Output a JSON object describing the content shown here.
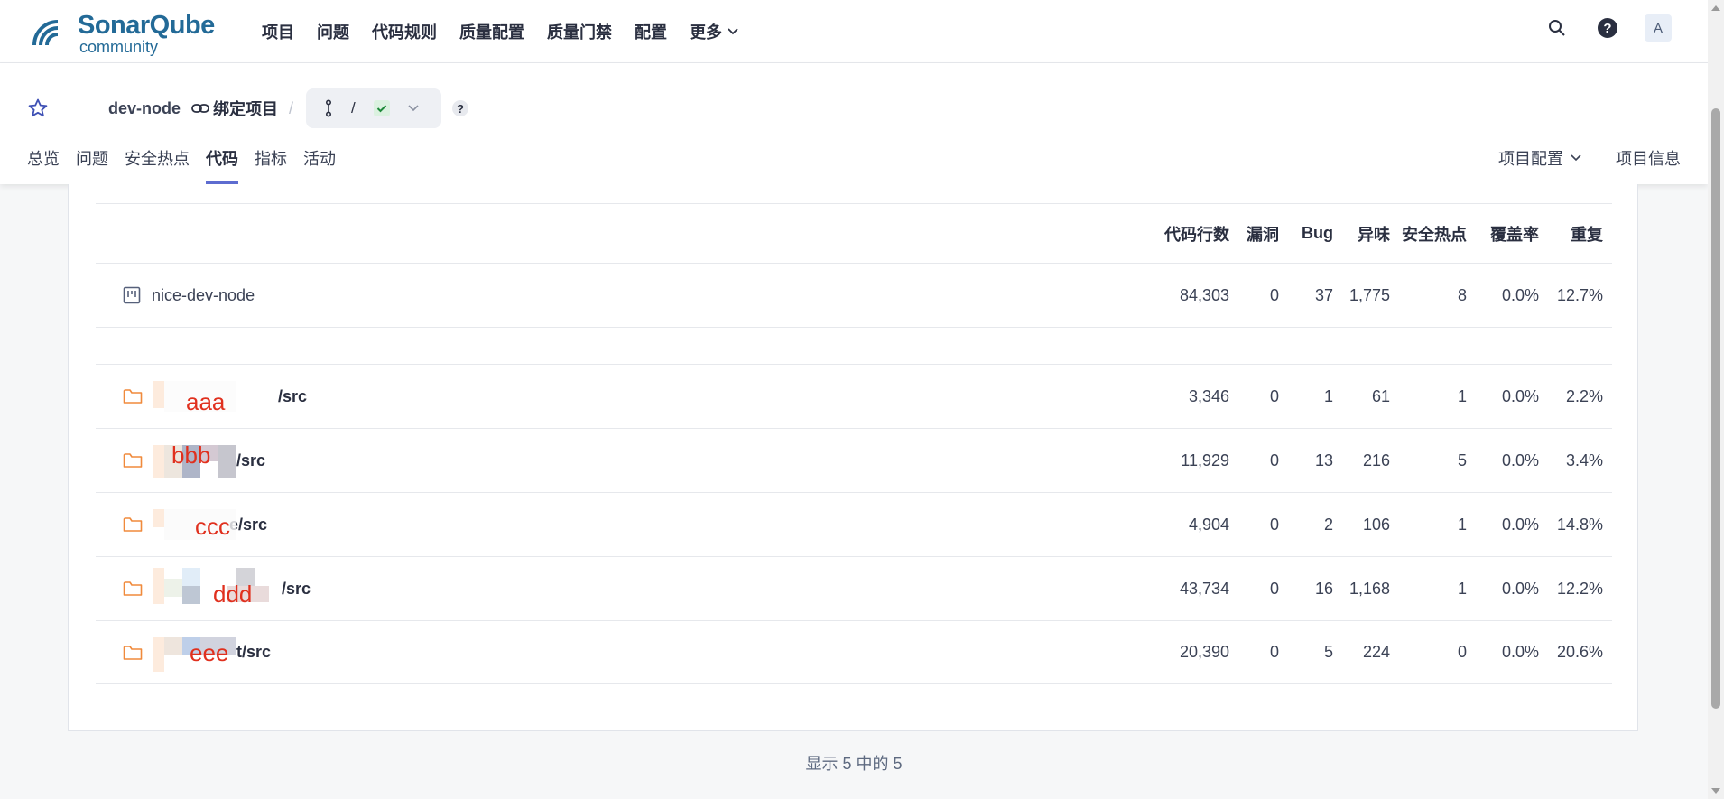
{
  "brand": {
    "name": "SonarQube",
    "edition": "community",
    "color": "#236a97"
  },
  "nav": {
    "items": [
      "项目",
      "问题",
      "代码规则",
      "质量配置",
      "质量门禁",
      "配置"
    ],
    "more": "更多"
  },
  "user": {
    "avatar_letter": "A"
  },
  "project": {
    "name": "dev-node",
    "bind_label": "绑定项目",
    "branch_sep": "/",
    "help": "?"
  },
  "tabs": {
    "items": [
      "总览",
      "问题",
      "安全热点",
      "代码",
      "指标",
      "活动"
    ],
    "active": "代码",
    "config": "项目配置",
    "info": "项目信息"
  },
  "table": {
    "columns": [
      "代码行数",
      "漏洞",
      "Bug",
      "异味",
      "安全热点",
      "覆盖率",
      "重复"
    ],
    "root": {
      "name": "nice-dev-node",
      "values": [
        "84,303",
        "0",
        "37",
        "1,775",
        "8",
        "0.0%",
        "12.7%"
      ]
    },
    "rows": [
      {
        "suffix": "/src",
        "redact_label": "aaa",
        "values": [
          "3,346",
          "0",
          "1",
          "61",
          "1",
          "0.0%",
          "2.2%"
        ]
      },
      {
        "suffix": "/src",
        "redact_label": "bbb",
        "values": [
          "11,929",
          "0",
          "13",
          "216",
          "5",
          "0.0%",
          "3.4%"
        ]
      },
      {
        "suffix": "e/src",
        "redact_label": "ccc",
        "values": [
          "4,904",
          "0",
          "2",
          "106",
          "1",
          "0.0%",
          "14.8%"
        ]
      },
      {
        "suffix": "/src",
        "redact_label": "ddd",
        "values": [
          "43,734",
          "0",
          "16",
          "1,168",
          "1",
          "0.0%",
          "12.2%"
        ]
      },
      {
        "suffix": "t/src",
        "redact_label": "eee",
        "values": [
          "20,390",
          "0",
          "5",
          "224",
          "0",
          "0.0%",
          "20.6%"
        ]
      }
    ]
  },
  "footer": {
    "text": "显示 5 中的 5"
  },
  "colors": {
    "accent": "#5d6cd0",
    "folder": "#f08a3c",
    "redact_text": "#e0301e"
  }
}
